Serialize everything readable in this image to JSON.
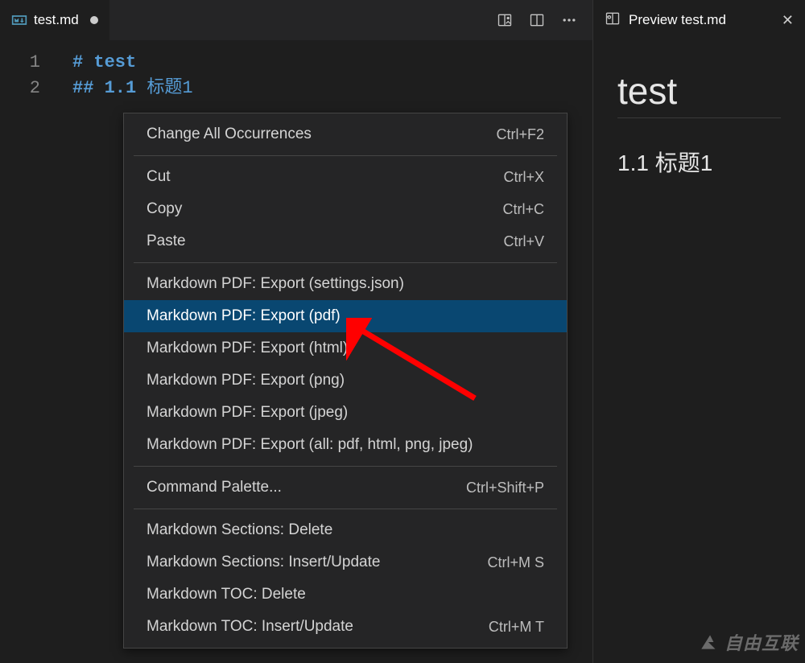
{
  "editor": {
    "tab": {
      "filename": "test.md",
      "dirty": true
    },
    "lines": [
      {
        "n": "1",
        "hash": "#",
        "text": "test"
      },
      {
        "n": "2",
        "hash": "##",
        "prefix": "1.1",
        "text": "标题1"
      }
    ],
    "actions": {
      "preview_side": "preview-side",
      "split": "split",
      "more": "more"
    }
  },
  "context_menu": {
    "groups": [
      [
        {
          "label": "Change All Occurrences",
          "shortcut": "Ctrl+F2"
        }
      ],
      [
        {
          "label": "Cut",
          "shortcut": "Ctrl+X"
        },
        {
          "label": "Copy",
          "shortcut": "Ctrl+C"
        },
        {
          "label": "Paste",
          "shortcut": "Ctrl+V"
        }
      ],
      [
        {
          "label": "Markdown PDF: Export (settings.json)"
        },
        {
          "label": "Markdown PDF: Export (pdf)",
          "highlight": true
        },
        {
          "label": "Markdown PDF: Export (html)"
        },
        {
          "label": "Markdown PDF: Export (png)"
        },
        {
          "label": "Markdown PDF: Export (jpeg)"
        },
        {
          "label": "Markdown PDF: Export (all: pdf, html, png, jpeg)"
        }
      ],
      [
        {
          "label": "Command Palette...",
          "shortcut": "Ctrl+Shift+P"
        }
      ],
      [
        {
          "label": "Markdown Sections: Delete"
        },
        {
          "label": "Markdown Sections: Insert/Update",
          "shortcut": "Ctrl+M S"
        },
        {
          "label": "Markdown TOC: Delete"
        },
        {
          "label": "Markdown TOC: Insert/Update",
          "shortcut": "Ctrl+M T"
        }
      ]
    ]
  },
  "preview": {
    "tab_label": "Preview test.md",
    "h1": "test",
    "h2": "1.1 标题1"
  },
  "watermark": "自由互联"
}
